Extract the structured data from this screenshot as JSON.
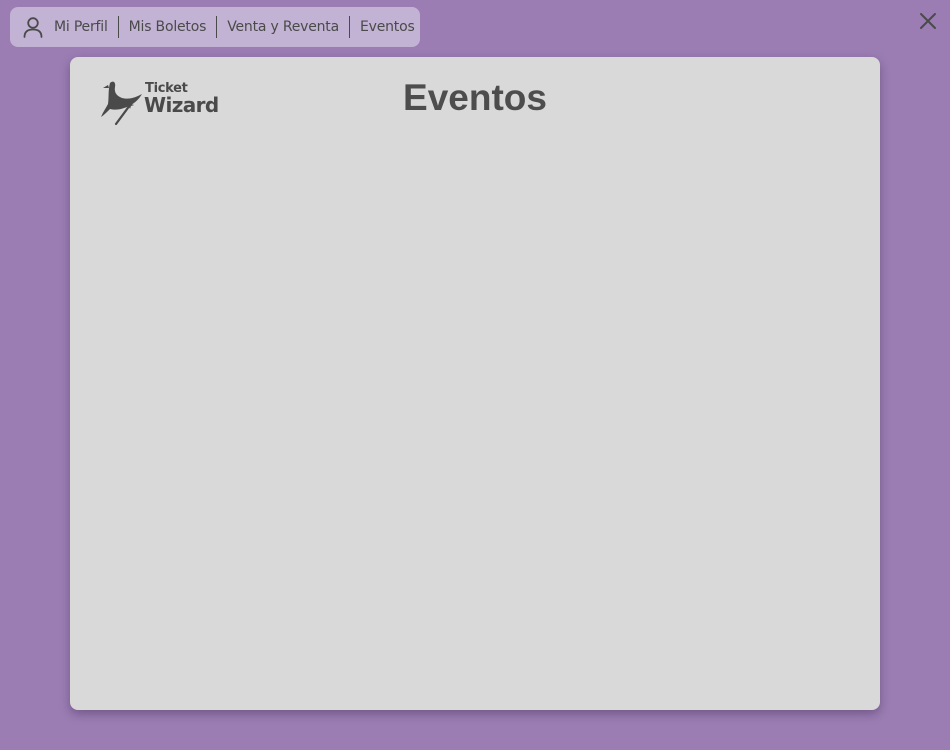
{
  "nav": {
    "items": [
      {
        "label": "Mi Perfil"
      },
      {
        "label": "Mis Boletos"
      },
      {
        "label": "Venta y Reventa"
      },
      {
        "label": "Eventos"
      }
    ]
  },
  "logo": {
    "line1": "Ticket",
    "line2": "Wizard"
  },
  "main": {
    "title": "Eventos"
  },
  "icons": {
    "user": "user-icon",
    "close": "close-icon",
    "logo_bird": "bird-wand-icon"
  },
  "colors": {
    "background": "#9b7db3",
    "navbar": "#c2b3d4",
    "panel": "#d9d9d9",
    "text": "#4a4a4a"
  }
}
